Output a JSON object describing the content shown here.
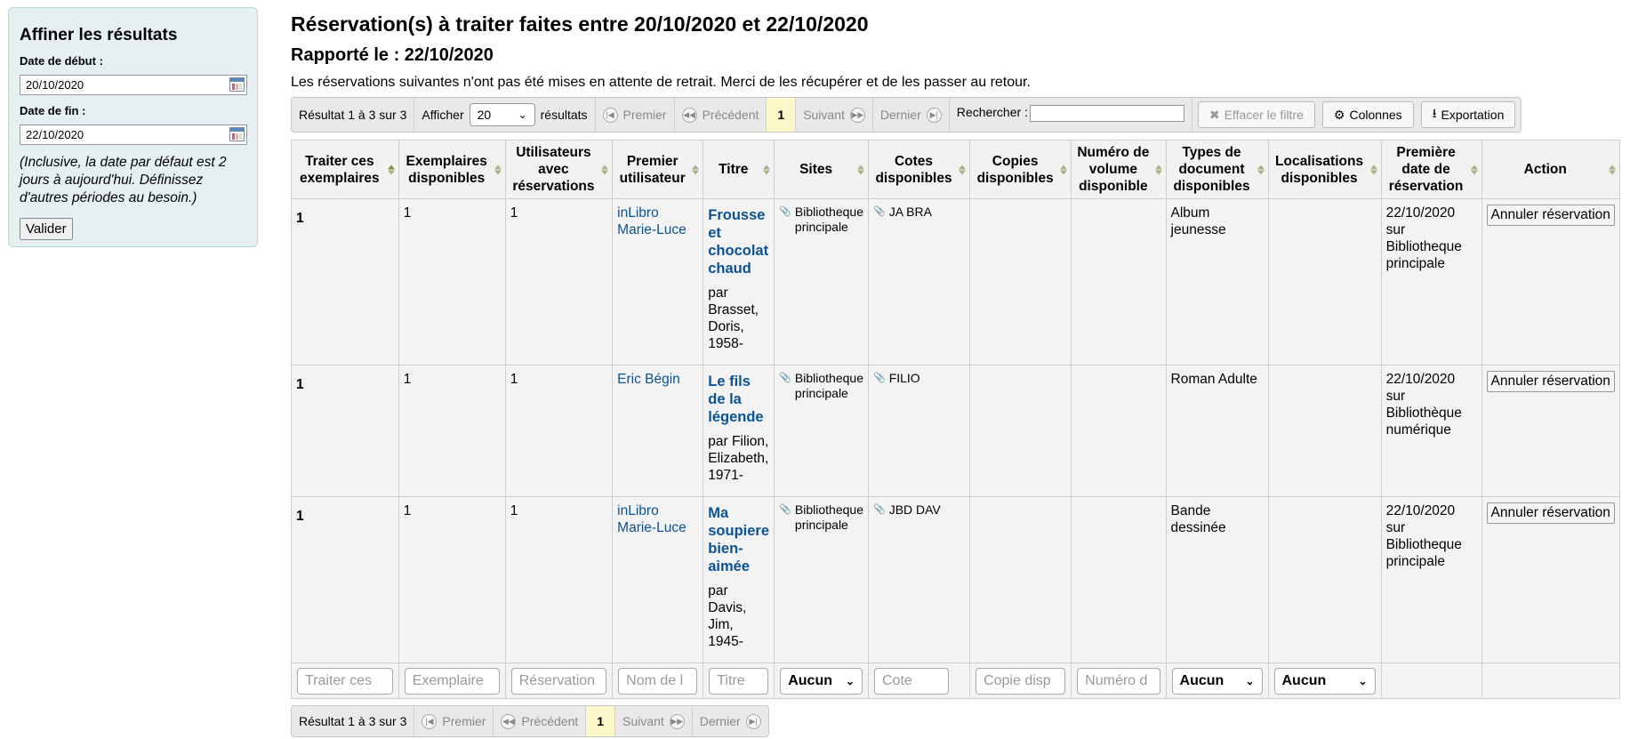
{
  "sidebar": {
    "heading": "Affiner les résultats",
    "start_label": "Date de début :",
    "start_value": "20/10/2020",
    "end_label": "Date de fin :",
    "end_value": "22/10/2020",
    "hint": "(Inclusive, la date par défaut est 2 jours à aujourd'hui. Définissez d'autres périodes au besoin.)",
    "submit_label": "Valider"
  },
  "header": {
    "title": "Réservation(s) à traiter faites entre 20/10/2020 et 22/10/2020",
    "reported": "Rapporté le : 22/10/2020",
    "intro": "Les réservations suivantes n'ont pas été mises en attente de retrait. Merci de les récupérer et de les passer au retour."
  },
  "toolbar": {
    "result_info": "Résultat 1 à 3 sur 3",
    "show_label": "Afficher",
    "page_size": "20",
    "results_label": "résultats",
    "first": "Premier",
    "previous": "Précédent",
    "current_page": "1",
    "next": "Suivant",
    "last": "Dernier",
    "search_label": "Rechercher :",
    "search_value": "",
    "clear_filter": "Effacer le filtre",
    "columns": "Colonnes",
    "export": "Exportation"
  },
  "table": {
    "headers": [
      "Traiter ces exemplaires",
      "Exemplaires disponibles",
      "Utilisateurs avec réservations",
      "Premier utilisateur",
      "Titre",
      "Sites",
      "Cotes disponibles",
      "Copies disponibles",
      "Numéro de volume disponible",
      "Types de document disponibles",
      "Localisations disponibles",
      "Première date de réservation",
      "Action"
    ],
    "rows": [
      {
        "traiter": "1",
        "exemplaires": "1",
        "utilisateurs": "1",
        "premier": "inLibro Marie-Luce",
        "titre": "Frousse et chocolat chaud",
        "auteur": "par Brasset, Doris, 1958-",
        "site": "Bibliotheque principale",
        "cote": "JA BRA",
        "copies": "",
        "volume": "",
        "type": "Album jeunesse",
        "localisation": "",
        "date": "22/10/2020 sur Bibliotheque principale",
        "action": "Annuler réservation"
      },
      {
        "traiter": "1",
        "exemplaires": "1",
        "utilisateurs": "1",
        "premier": "Eric Bégin",
        "titre": "Le fils de la légende",
        "auteur": "par Filion, Elizabeth, 1971-",
        "site": "Bibliotheque principale",
        "cote": "FILIO",
        "copies": "",
        "volume": "",
        "type": "Roman Adulte",
        "localisation": "",
        "date": "22/10/2020 sur Bibliothèque numérique",
        "action": "Annuler réservation"
      },
      {
        "traiter": "1",
        "exemplaires": "1",
        "utilisateurs": "1",
        "premier": "inLibro Marie-Luce",
        "titre": "Ma soupiere bien-aimée",
        "auteur": "par Davis, Jim, 1945-",
        "site": "Bibliotheque principale",
        "cote": "JBD DAV",
        "copies": "",
        "volume": "",
        "type": "Bande dessinée",
        "localisation": "",
        "date": "22/10/2020 sur Bibliotheque principale",
        "action": "Annuler réservation"
      }
    ],
    "filters": {
      "traiter": "Traiter ces",
      "exemplaires": "Exemplaire",
      "reservations": "Réservation",
      "nom": "Nom de l",
      "titre": "Titre",
      "sites": "Aucun",
      "cote": "Cote",
      "copie": "Copie disp",
      "numero": "Numéro d",
      "types": "Aucun",
      "localisations": "Aucun"
    }
  },
  "bottom_pager": {
    "result_info": "Résultat 1 à 3 sur 3",
    "first": "Premier",
    "previous": "Précédent",
    "current_page": "1",
    "next": "Suivant",
    "last": "Dernier"
  }
}
